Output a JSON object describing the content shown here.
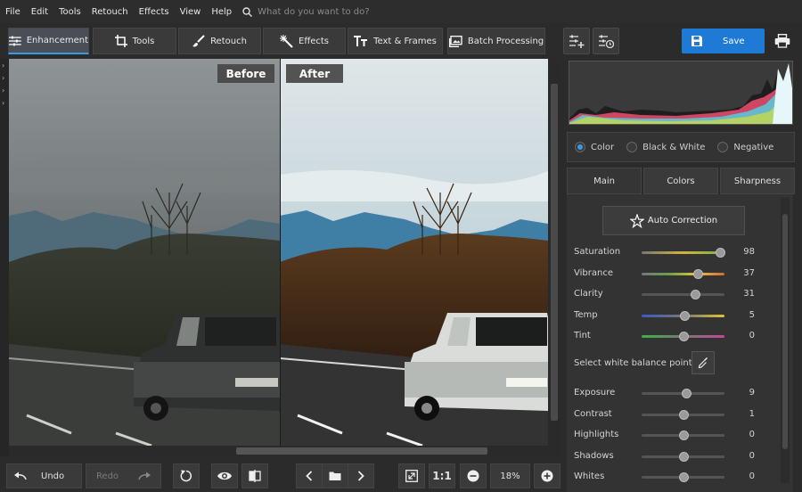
{
  "menu": {
    "items": [
      "File",
      "Edit",
      "Tools",
      "Retouch",
      "Effects",
      "View",
      "Help"
    ],
    "search_placeholder": "What do you want to do?"
  },
  "tabs": [
    {
      "label": "Enhancement",
      "icon": "sliders-icon",
      "active": true
    },
    {
      "label": "Tools",
      "icon": "crop-icon"
    },
    {
      "label": "Retouch",
      "icon": "brush-icon"
    },
    {
      "label": "Effects",
      "icon": "magic-wand-icon"
    },
    {
      "label": "Text & Frames",
      "icon": "text-icon"
    },
    {
      "label": "Batch Processing",
      "icon": "batch-images-icon"
    }
  ],
  "header": {
    "save_label": "Save"
  },
  "compare": {
    "before": "Before",
    "after": "After"
  },
  "bottom": {
    "undo": "Undo",
    "redo": "Redo",
    "ratio": "1:1",
    "zoom": "18%"
  },
  "color_modes": {
    "items": [
      "Color",
      "Black & White",
      "Negative"
    ],
    "selected": "Color"
  },
  "panel_tabs": [
    {
      "label": "Main",
      "active": true
    },
    {
      "label": "Colors"
    },
    {
      "label": "Sharpness"
    }
  ],
  "auto_correction": "Auto Correction",
  "white_balance": "Select white balance point",
  "sliders_a": [
    {
      "name": "Saturation",
      "value": "98",
      "pos": 0.95
    },
    {
      "name": "Vibrance",
      "value": "37",
      "pos": 0.68
    },
    {
      "name": "Clarity",
      "value": "31",
      "pos": 0.65
    },
    {
      "name": "Temp",
      "value": "5",
      "pos": 0.52
    },
    {
      "name": "Tint",
      "value": "0",
      "pos": 0.5
    }
  ],
  "sliders_b": [
    {
      "name": "Exposure",
      "value": "9",
      "pos": 0.54
    },
    {
      "name": "Contrast",
      "value": "1",
      "pos": 0.5
    },
    {
      "name": "Highlights",
      "value": "0",
      "pos": 0.5
    },
    {
      "name": "Shadows",
      "value": "0",
      "pos": 0.5
    },
    {
      "name": "Whites",
      "value": "0",
      "pos": 0.5
    }
  ],
  "colors": {
    "accent": "#1f7ad6",
    "tab_highlight": "#3b9ae8"
  }
}
